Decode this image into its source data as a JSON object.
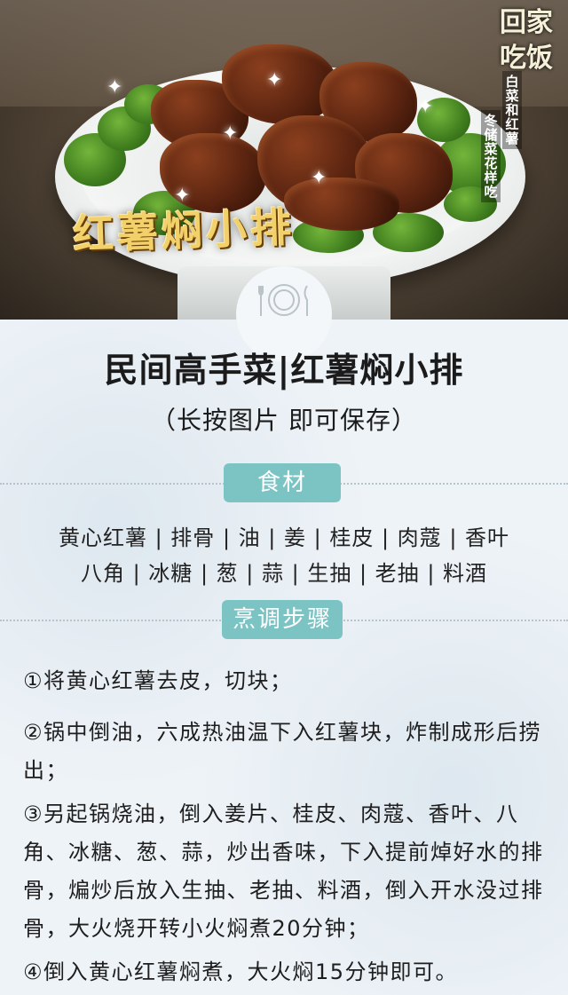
{
  "hero": {
    "dish_title": "红薯焖小排",
    "logo_text": "回家吃饭",
    "caption_right": "白菜和红薯",
    "caption_left": "冬储菜花样吃",
    "plate_icon": "fork-plate-knife-icon"
  },
  "header": {
    "title": "民间高手菜|红薯焖小排",
    "subtitle": "（长按图片  即可保存）"
  },
  "ingredients_section": {
    "label": "食材",
    "lines": [
      "黄心红薯 | 排骨 | 油 | 姜 | 桂皮 | 肉蔻 | 香叶",
      "八角 | 冰糖 | 葱 | 蒜 | 生抽 | 老抽 | 料酒"
    ]
  },
  "steps_section": {
    "label": "烹调步骤",
    "steps": [
      "①将黄心红薯去皮，切块；",
      "②锅中倒油，六成热油温下入红薯块，炸制成形后捞出；",
      "③另起锅烧油，倒入姜片、桂皮、肉蔻、香叶、八角、冰糖、葱、蒜，炒出香味，下入提前焯好水的排骨，煸炒后放入生抽、老抽、料酒，倒入开水没过排骨，大火烧开转小火焖煮20分钟；",
      "④倒入黄心红薯焖煮，大火焖15分钟即可。"
    ]
  },
  "colors": {
    "pill": "#7cc3c4",
    "paper": "#eef3f7",
    "title_gold": "#f2d16b"
  }
}
